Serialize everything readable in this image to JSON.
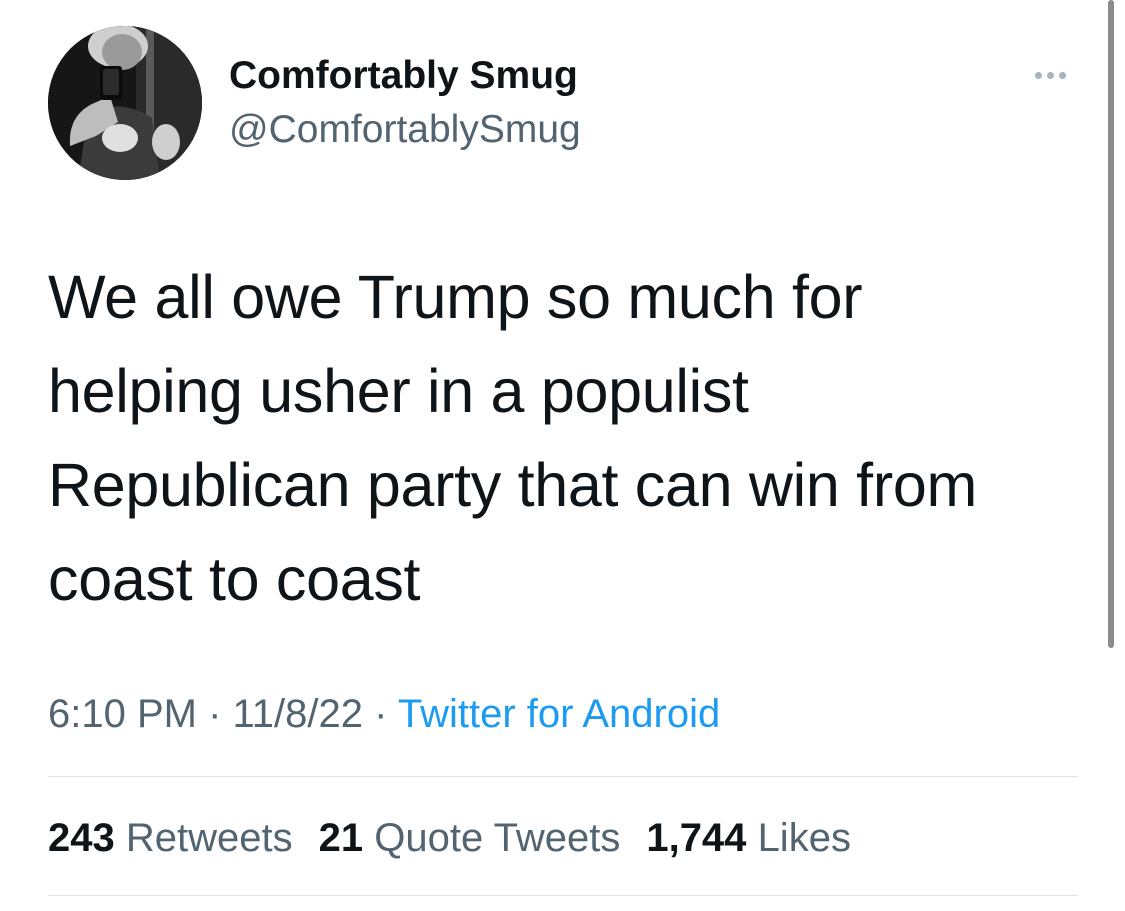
{
  "tweet": {
    "author": {
      "display_name": "Comfortably Smug",
      "handle": "@ComfortablySmug"
    },
    "text_lines": [
      "We all owe Trump so much for",
      "helping usher in a populist",
      "Republican party that can win from",
      "coast to coast"
    ],
    "meta": {
      "time": "6:10 PM",
      "separator": " · ",
      "date": "11/8/22",
      "source": "Twitter for Android"
    },
    "stats": {
      "retweets_count": "243",
      "retweets_label": "Retweets",
      "quotes_count": "21",
      "quotes_label": "Quote Tweets",
      "likes_count": "1,744",
      "likes_label": "Likes"
    }
  },
  "colors": {
    "text": "#0f1419",
    "secondary": "#536471",
    "link": "#1d9bf0",
    "divider": "#e1e5e8"
  },
  "icons": {
    "more": "more-horizontal-icon"
  }
}
